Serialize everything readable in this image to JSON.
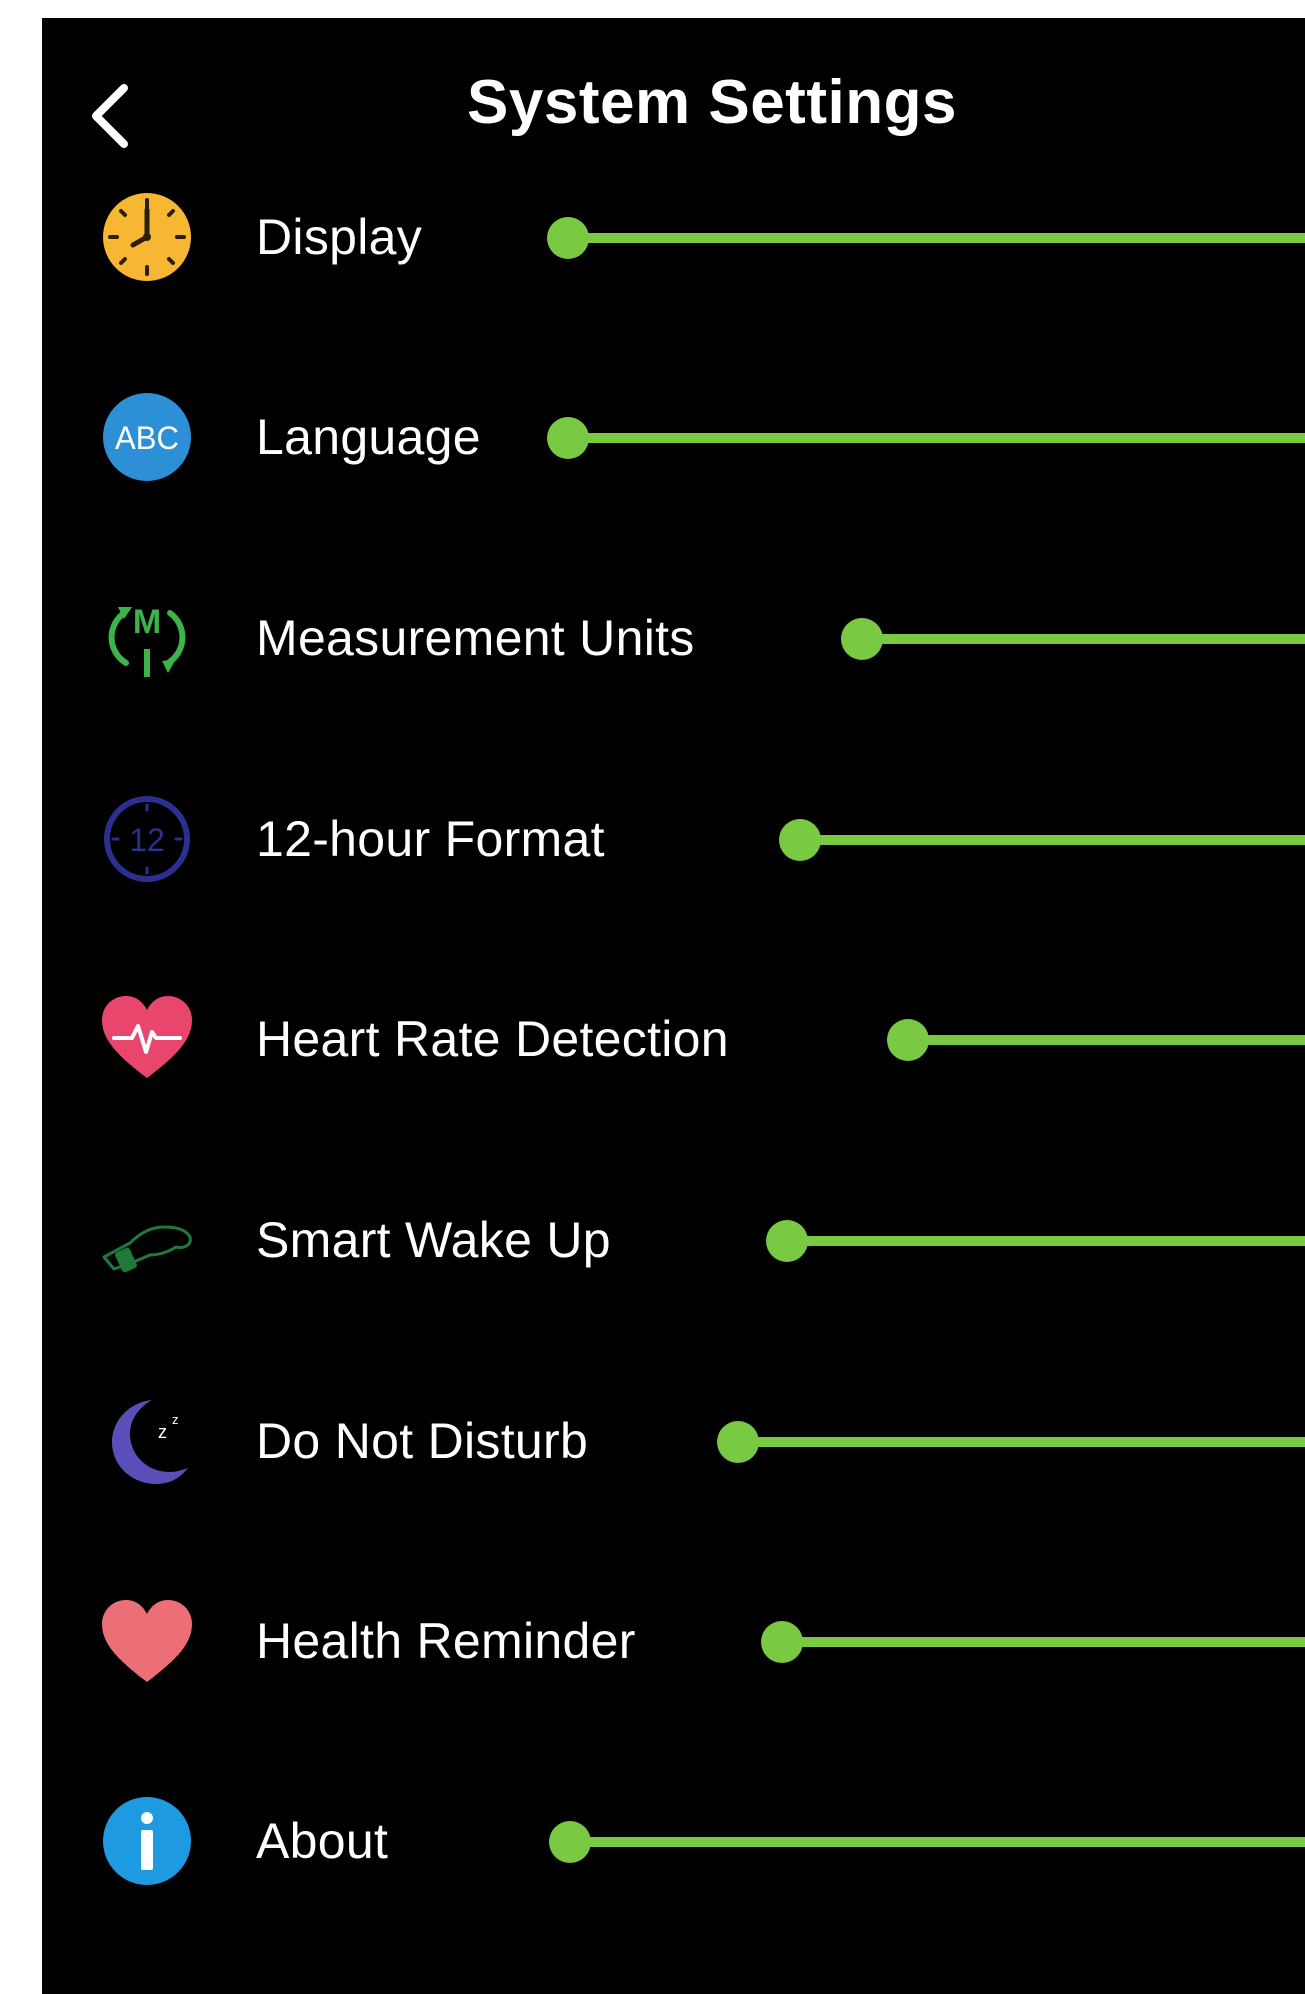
{
  "header": {
    "title": "System Settings",
    "back_icon": "chevron-left-icon"
  },
  "accent_color": "#7ac943",
  "settings": [
    {
      "label": "Display",
      "icon": "clock-icon",
      "icon_color": "#f7b733"
    },
    {
      "label": "Language",
      "icon": "abc-icon",
      "icon_color": "#2d8fd5"
    },
    {
      "label": "Measurement Units",
      "icon": "measurement-units-icon",
      "icon_color": "#3cb44a"
    },
    {
      "label": "12-hour Format",
      "icon": "twelve-hour-clock-icon",
      "icon_color": "#2b2f8f"
    },
    {
      "label": "Heart Rate Detection",
      "icon": "heart-rate-icon",
      "icon_color": "#e8466c"
    },
    {
      "label": "Smart Wake Up",
      "icon": "wrist-icon",
      "icon_color": "#1f7a3a"
    },
    {
      "label": "Do Not Disturb",
      "icon": "moon-icon",
      "icon_color": "#5a4fb8"
    },
    {
      "label": "Health Reminder",
      "icon": "heart-icon",
      "icon_color": "#ec6f78"
    },
    {
      "label": "About",
      "icon": "info-icon",
      "icon_color": "#1e9be0"
    }
  ]
}
